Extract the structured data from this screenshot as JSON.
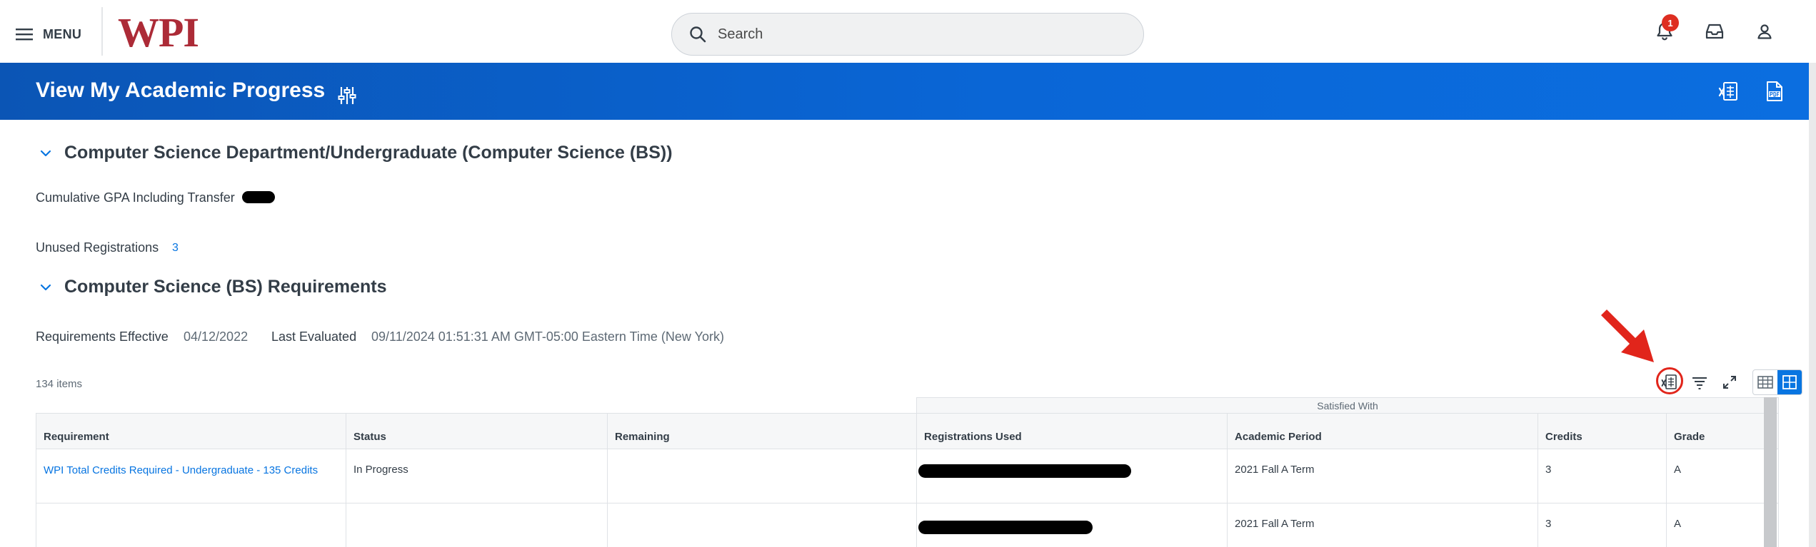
{
  "topbar": {
    "menu_label": "MENU",
    "brand": "WPI",
    "search_placeholder": "Search",
    "notification_count": "1",
    "icons": [
      "menu-icon",
      "search-icon",
      "bell-icon",
      "inbox-icon",
      "user-icon"
    ]
  },
  "header": {
    "title": "View My Academic Progress",
    "icons": [
      "filter-sliders-icon",
      "export-excel-icon",
      "export-pdf-icon"
    ]
  },
  "program_section": {
    "title": "Computer Science Department/Undergraduate (Computer Science (BS))",
    "gpa_label": "Cumulative GPA Including Transfer",
    "unused_label": "Unused Registrations",
    "unused_value": "3"
  },
  "requirements_section": {
    "title": "Computer Science (BS) Requirements",
    "effective_label": "Requirements Effective",
    "effective_value": "04/12/2022",
    "evaluated_label": "Last Evaluated",
    "evaluated_value": "09/11/2024 01:51:31 AM GMT-05:00 Eastern Time (New York)"
  },
  "grid": {
    "items_count": "134 items",
    "group_header": "Satisfied With",
    "columns": [
      "Requirement",
      "Status",
      "Remaining",
      "Registrations Used",
      "Academic Period",
      "Credits",
      "Grade"
    ],
    "rows": [
      {
        "requirement": "WPI Total Credits Required - Undergraduate - 135 Credits",
        "status": "In Progress",
        "remaining": "",
        "academic_period": "2021 Fall A Term",
        "credits": "3",
        "grade": "A"
      },
      {
        "requirement": "",
        "status": "",
        "remaining": "",
        "academic_period": "2021 Fall A Term",
        "credits": "3",
        "grade": "A"
      }
    ]
  },
  "colors": {
    "brand_red": "#ac2b37",
    "header_blue": "#0a66d6",
    "link_blue": "#0875e1",
    "annotation_red": "#e1251b"
  }
}
